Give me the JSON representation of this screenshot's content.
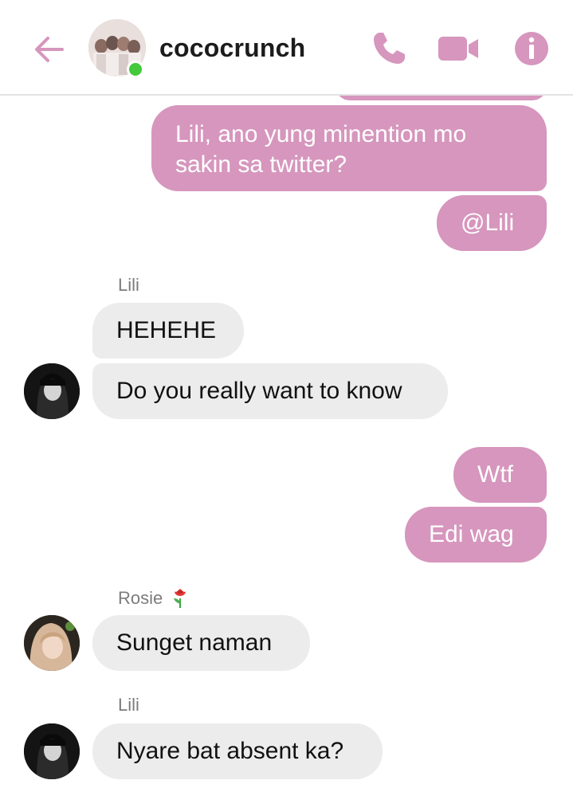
{
  "header": {
    "title": "cococrunch",
    "online": true,
    "accent_color": "#d696bd",
    "online_color": "#44c93a",
    "icons": [
      "back-arrow-icon",
      "phone-icon",
      "video-camera-icon",
      "info-icon"
    ]
  },
  "messages": [
    {
      "direction": "outgoing",
      "text_lines": [
        "Lili, ano yung minention mo",
        "sakin sa twitter?"
      ]
    },
    {
      "direction": "outgoing",
      "text": "@Lili"
    },
    {
      "direction": "incoming",
      "sender": "Lili",
      "text": "HEHEHE"
    },
    {
      "direction": "incoming",
      "sender": "Lili",
      "text": "Do you really want to know"
    },
    {
      "direction": "outgoing",
      "text": "Wtf"
    },
    {
      "direction": "outgoing",
      "text": "Edi wag"
    },
    {
      "direction": "incoming",
      "sender": "Rosie",
      "sender_emoji": "rose-icon",
      "text": "Sunget naman"
    },
    {
      "direction": "incoming",
      "sender": "Lili",
      "text": "Nyare bat absent ka?"
    }
  ],
  "colors": {
    "outgoing_bubble": "#d696bd",
    "incoming_bubble": "#ececec",
    "sender_name": "#7c7c7c"
  }
}
